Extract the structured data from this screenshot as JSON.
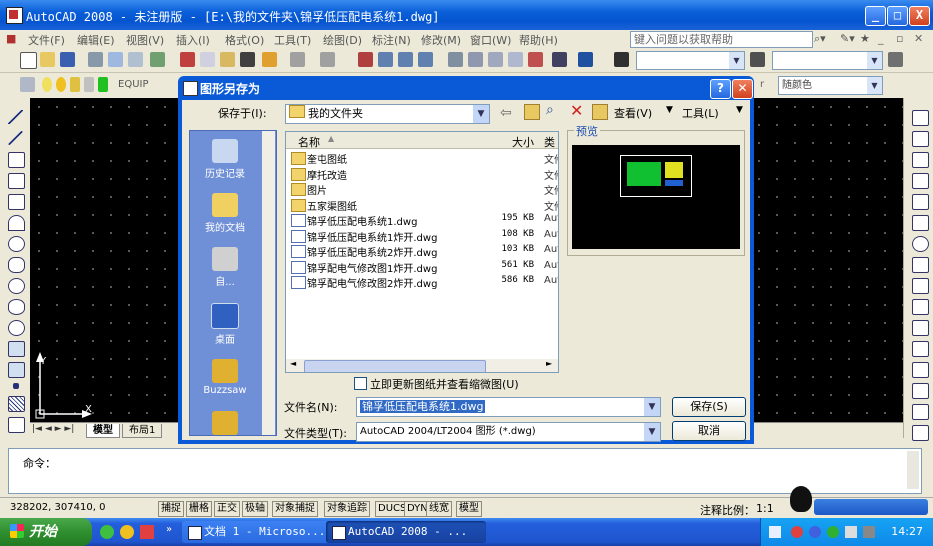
{
  "window": {
    "title": "AutoCAD 2008 - 未注册版 - [E:\\我的文件夹\\锦孚低压配电系统1.dwg]",
    "controls": [
      "_",
      "□",
      "X"
    ]
  },
  "menu": {
    "items": [
      "文件(F)",
      "编辑(E)",
      "视图(V)",
      "插入(I)",
      "格式(O)",
      "工具(T)",
      "绘图(D)",
      "标注(N)",
      "修改(M)",
      "窗口(W)",
      "帮助(H)"
    ],
    "help_placeholder": "键入问题以获取帮助"
  },
  "toolbar": {
    "layer_name": "EQUIP",
    "color_value": "随颜色",
    "linetype_value": "r"
  },
  "drawing": {
    "ucs_x": "X",
    "ucs_y": "Y",
    "tabs": [
      "模型",
      "布局1"
    ]
  },
  "command": {
    "prompt": "命令："
  },
  "statusbar": {
    "coords": "328202, 307410, 0",
    "toggles": [
      "捕捉",
      "栅格",
      "正交",
      "极轴",
      "对象捕捉",
      "对象追踪",
      "DUCS",
      "DYN",
      "线宽",
      "模型"
    ],
    "annotation_scale_label": "注释比例：",
    "annotation_scale_value": "1:1"
  },
  "dialog": {
    "title": "图形另存为",
    "save_in_label": "保存于(I):",
    "save_in_value": "我的文件夹",
    "view_label": "查看(V)",
    "tools_label": "工具(L)",
    "preview_label": "预览",
    "places": [
      "历史记录",
      "我的文档",
      "自...",
      "桌面",
      "Buzzsaw"
    ],
    "columns": [
      "名称",
      "大小",
      "类"
    ],
    "files": [
      {
        "name": "奎屯图纸",
        "size": "",
        "type": "文件",
        "kind": "folder"
      },
      {
        "name": "摩托改造",
        "size": "",
        "type": "文件",
        "kind": "folder"
      },
      {
        "name": "图片",
        "size": "",
        "type": "文件",
        "kind": "folder"
      },
      {
        "name": "五家渠图纸",
        "size": "",
        "type": "文件",
        "kind": "folder"
      },
      {
        "name": "锦孚低压配电系统1.dwg",
        "size": "195 KB",
        "type": "Aut",
        "kind": "dwg"
      },
      {
        "name": "锦孚低压配电系统1炸开.dwg",
        "size": "108 KB",
        "type": "Aut",
        "kind": "dwg"
      },
      {
        "name": "锦孚低压配电系统2炸开.dwg",
        "size": "103 KB",
        "type": "Aut",
        "kind": "dwg"
      },
      {
        "name": "锦孚配电气修改图1炸开.dwg",
        "size": "561 KB",
        "type": "Aut",
        "kind": "dwg"
      },
      {
        "name": "锦孚配电气修改图2炸开.dwg",
        "size": "586 KB",
        "type": "Aut",
        "kind": "dwg"
      }
    ],
    "update_thumb_label": "立即更新图纸并查看缩微图(U)",
    "filename_label": "文件名(N):",
    "filename_value": "锦孚低压配电系统1.dwg",
    "filetype_label": "文件类型(T):",
    "filetype_value": "AutoCAD 2004/LT2004 图形 (*.dwg)",
    "save_button": "保存(S)",
    "cancel_button": "取消"
  },
  "taskbar": {
    "start_label": "开始",
    "tasks": [
      "文档 1 - Microso...",
      "AutoCAD 2008 - ..."
    ],
    "clock": "14:27"
  }
}
